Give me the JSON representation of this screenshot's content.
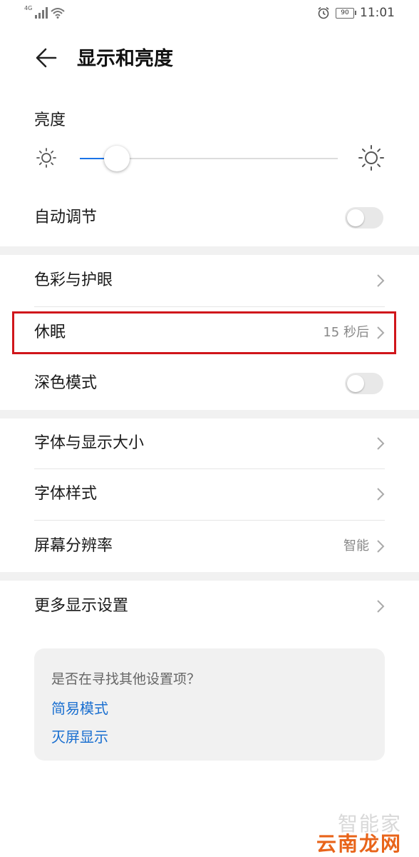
{
  "status_bar": {
    "network": "4G",
    "battery": "90",
    "time": "11:01"
  },
  "header": {
    "title": "显示和亮度"
  },
  "brightness": {
    "label": "亮度",
    "level_fraction": 0.095
  },
  "auto_adjust": {
    "label": "自动调节",
    "on": false
  },
  "rows": {
    "color_eye": {
      "label": "色彩与护眼"
    },
    "sleep": {
      "label": "休眠",
      "value": "15 秒后"
    },
    "dark_mode": {
      "label": "深色模式",
      "on": false
    },
    "font_size": {
      "label": "字体与显示大小"
    },
    "font_style": {
      "label": "字体样式"
    },
    "resolution": {
      "label": "屏幕分辨率",
      "value": "智能"
    },
    "more_display": {
      "label": "更多显示设置"
    }
  },
  "tip": {
    "question": "是否在寻找其他设置项？",
    "link1": "简易模式",
    "link2": "灭屏显示"
  },
  "watermark": {
    "top": "智能家",
    "bottom": "云南龙网"
  },
  "colors": {
    "accent": "#1a73e8",
    "highlight": "#d0161b",
    "link": "#1a6fd0"
  }
}
